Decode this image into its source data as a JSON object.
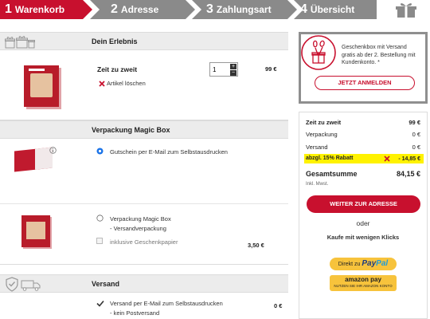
{
  "steps": [
    {
      "num": "1",
      "label": "Warenkorb"
    },
    {
      "num": "2",
      "label": "Adresse"
    },
    {
      "num": "3",
      "label": "Zahlungsart"
    },
    {
      "num": "4",
      "label": "Übersicht"
    }
  ],
  "icons": {
    "gift_boxes": "gift-boxes-icon",
    "info": "info-icon",
    "delete": "delete-x-icon",
    "check": "check-icon",
    "shield": "shield-check-icon",
    "truck": "delivery-truck-icon",
    "gift_balloons": "gift-balloons-icon"
  },
  "colors": {
    "accent": "#c8102e",
    "highlight": "#fff200",
    "gray_step": "#8a8a8a"
  },
  "erlebnis": {
    "header": "Dein Erlebnis",
    "product_name": "Zeit zu zweit",
    "quantity": "1",
    "price": "99 €",
    "delete_label": "Artikel löschen"
  },
  "verpackung": {
    "header": "Verpackung Magic Box",
    "option_email": "Gutschein per E-Mail zum Selbstausdrucken",
    "option_box_line1": "Verpackung Magic Box",
    "option_box_line2": "- Versandverpackung",
    "option_paper": "inklusive Geschenkpapier",
    "option_box_price": "3,50 €"
  },
  "versand": {
    "header": "Versand",
    "line1": "Versand per E-Mail zum Selbstausdrucken",
    "line2": "- kein Postversand",
    "price": "0 €"
  },
  "promo": {
    "text": "Geschenkbox mit Versand gratis ab der 2. Bestellung mit Kundenkonto. *",
    "button": "JETZT ANMELDEN"
  },
  "summary": {
    "item_label": "Zeit zu zweit",
    "item_value": "99 €",
    "verpackung_label": "Verpackung",
    "verpackung_value": "0 €",
    "versand_label": "Versand",
    "versand_value": "0 €",
    "rabatt_label": "abzgl. 15% Rabatt",
    "rabatt_value": "- 14,85 €",
    "total_label": "Gesamtsumme",
    "total_value": "84,15 €",
    "vat_note": "Inkl. Mwst.",
    "cta": "WEITER ZUR ADRESSE",
    "or": "oder",
    "quick_buy": "Kaufe mit wenigen Klicks",
    "paypal_prefix": "Direkt zu",
    "paypal_brand_1": "Pay",
    "paypal_brand_2": "Pal",
    "amazon_brand": "amazon pay",
    "amazon_sub": "NUTZEN SIE IHR AMAZON KONTO"
  }
}
